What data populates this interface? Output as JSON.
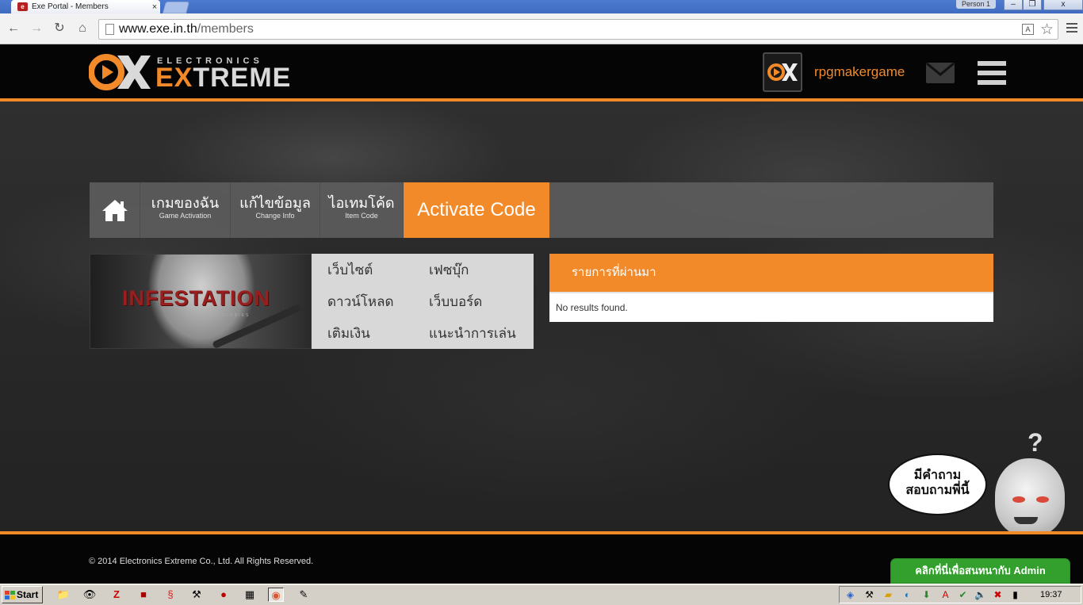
{
  "browser": {
    "tab_title": "Exe Portal - Members",
    "tab_close": "×",
    "profile": "Person 1",
    "controls": {
      "minimize": "–",
      "maximize": "❐",
      "close": "x"
    },
    "url_host": "www.exe.in.th",
    "url_path": "/members",
    "icons": {
      "back": "back-arrow-icon",
      "forward": "forward-arrow-icon",
      "reload": "reload-icon",
      "home": "home-icon",
      "bookmark": "star-icon"
    }
  },
  "header": {
    "logo_small": "ELECTRONICS",
    "logo_big_accent": "EX",
    "logo_big_rest": "TREME",
    "username": "rpgmakergame",
    "colors": {
      "accent": "#f28a2a",
      "header_bg": "#050505"
    }
  },
  "tabs": [
    {
      "icon": "home-icon"
    },
    {
      "th": "เกมของฉัน",
      "en": "Game Activation"
    },
    {
      "th": "แก้ไขข้อมูล",
      "en": "Change Info"
    },
    {
      "th": "ไอเทมโค้ด",
      "en": "Item Code"
    },
    {
      "label": "Activate Code",
      "active": true
    }
  ],
  "banner": {
    "title": "INFESTATION",
    "subtitle": "SURVIVOR STORIES"
  },
  "links": [
    "เว็บไซต์",
    "เฟซบุ๊ก",
    "ดาวน์โหลด",
    "เว็บบอร์ด",
    "เติมเงิน",
    "แนะนำการเล่น"
  ],
  "history": {
    "title": "รายการที่ผ่านมา",
    "empty": "No results found."
  },
  "mascot": {
    "bubble_line1": "มีคำถาม",
    "bubble_line2": "สอบถามพี่นี้"
  },
  "footer": {
    "copyright": "© 2014 Electronics Extreme Co., Ltd. All Rights Reserved."
  },
  "chat_button": "คลิกที่นี่เพื่อสนทนากับ Admin",
  "taskbar": {
    "start": "Start",
    "clock": "19:37"
  }
}
